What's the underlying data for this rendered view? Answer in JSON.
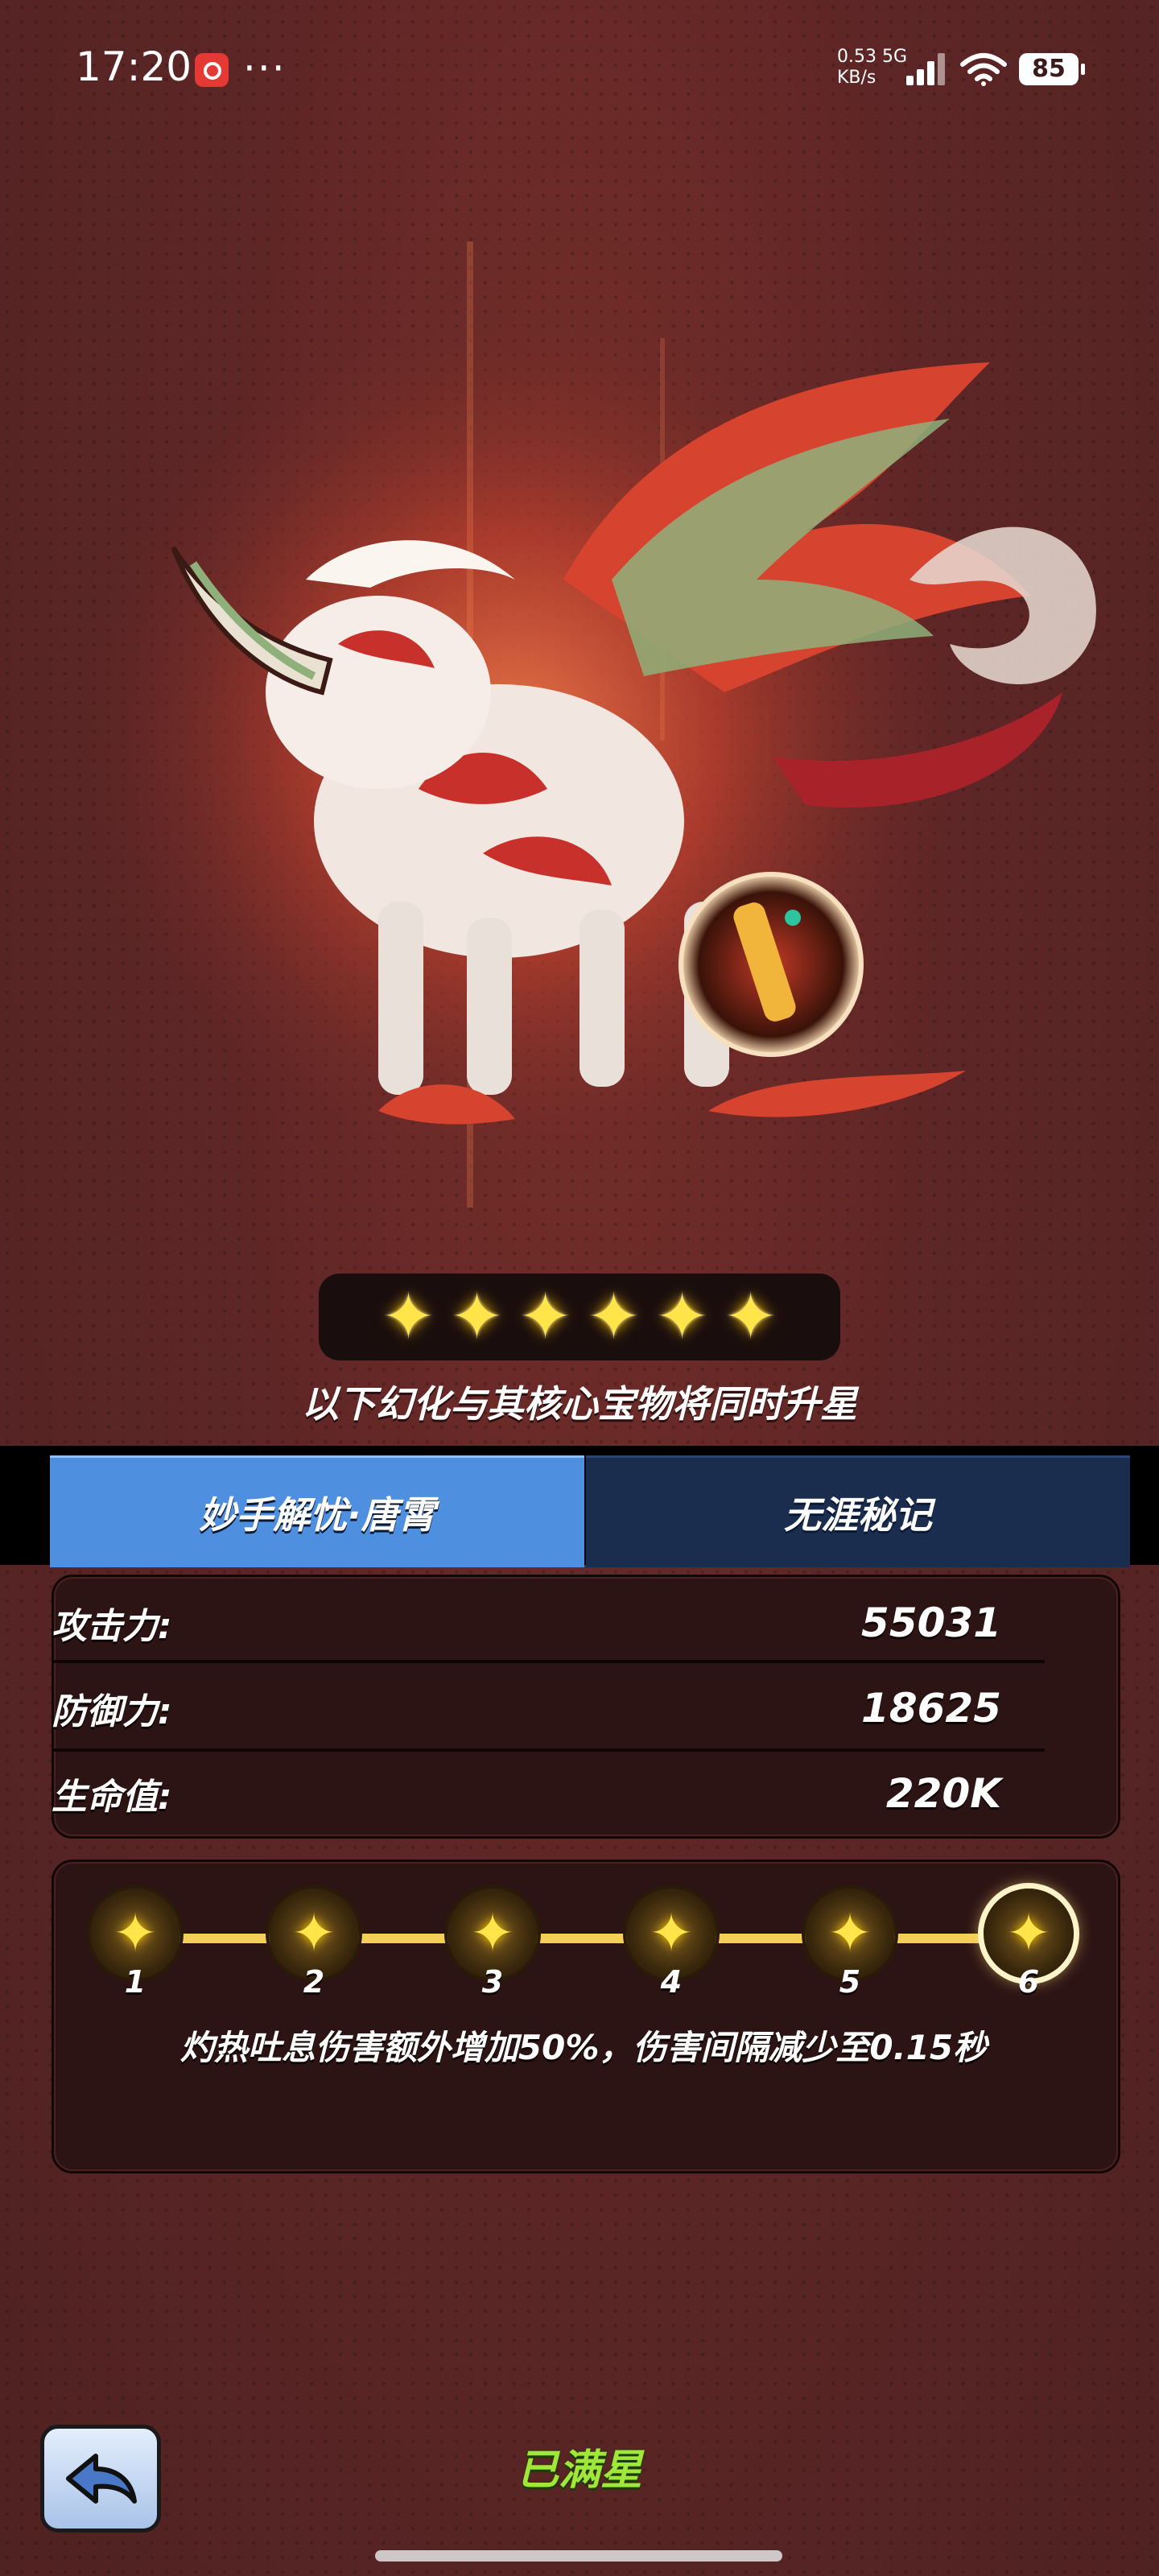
{
  "status_bar": {
    "time": "17:20",
    "network_speed": "0.53",
    "network_speed_unit": "KB/s",
    "network_type": "5G",
    "battery": "85"
  },
  "hero": {
    "star_count": 6,
    "stars": [
      "✦",
      "✦",
      "✦",
      "✦",
      "✦",
      "✦"
    ],
    "upgrade_note": "以下幻化与其核心宝物将同时升星"
  },
  "tabs": [
    {
      "label": "妙手解忧·唐霄",
      "selected": true
    },
    {
      "label": "无涯秘记",
      "selected": false
    }
  ],
  "stats": [
    {
      "label": "攻击力:",
      "value": "55031"
    },
    {
      "label": "防御力:",
      "value": "18625"
    },
    {
      "label": "生命值:",
      "value": "220K"
    }
  ],
  "star_levels": {
    "nodes": [
      "1",
      "2",
      "3",
      "4",
      "5",
      "6"
    ],
    "selected": "6",
    "description": "灼热吐息伤害额外增加50%，伤害间隔减少至0.15秒"
  },
  "footer": {
    "status": "已满星"
  },
  "colors": {
    "background": "#5e2626",
    "tab_active": "#4f8fdf",
    "tab_inactive": "#1a2d4f",
    "star_gold": "#ffe44a",
    "track": "#f4cf57",
    "maxed_green": "#9fe83a"
  },
  "icons": [
    "app-notification-icon",
    "signal-icon",
    "wifi-icon",
    "battery-icon",
    "back-arrow-icon",
    "star-icon"
  ]
}
